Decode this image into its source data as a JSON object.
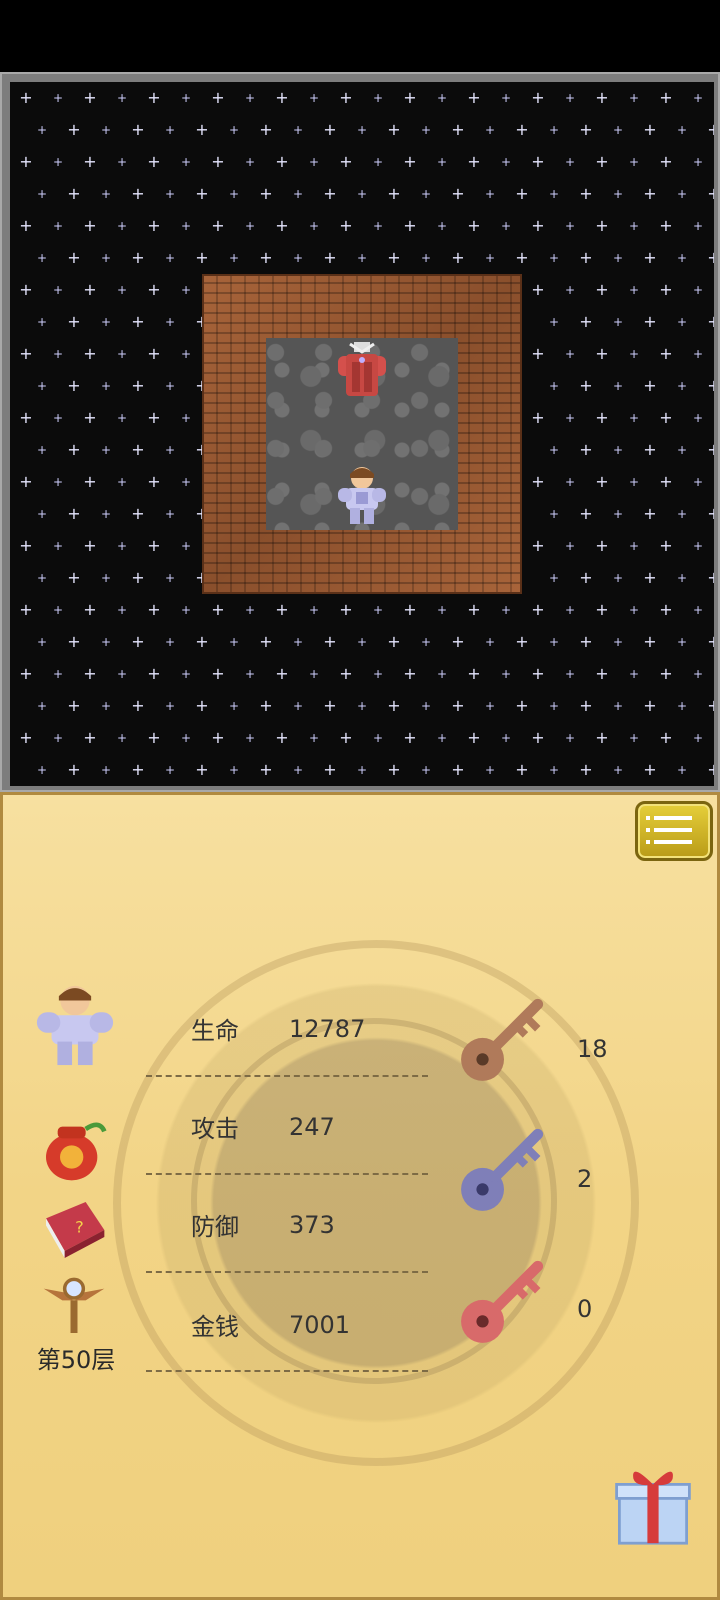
{
  "map": {
    "floor_number": 50
  },
  "status": {
    "stats": [
      {
        "label": "生命",
        "value": "12787"
      },
      {
        "label": "攻击",
        "value": "247"
      },
      {
        "label": "防御",
        "value": "373"
      },
      {
        "label": "金钱",
        "value": "7001"
      }
    ],
    "keys": [
      {
        "color_name": "yellow-key",
        "color": "#b07a5a",
        "count": "18"
      },
      {
        "color_name": "blue-key",
        "color": "#7f7fb8",
        "count": "2"
      },
      {
        "color_name": "red-key",
        "color": "#d86a6a",
        "count": "0"
      }
    ],
    "floor_label": "第50层"
  },
  "colors": {
    "panel_bg": "#f2d486",
    "map_bg": "#0b0b0b",
    "wall": "#a8643a",
    "floor": "#555555",
    "menu_button": "#d2b828"
  },
  "icons": {
    "menu": "list-menu-icon",
    "hero": "hero-icon",
    "lucky_bag": "lucky-bag-icon",
    "monster_book": "monster-book-icon",
    "fly_wand": "fly-emblem-icon",
    "gift": "gift-box-icon"
  }
}
